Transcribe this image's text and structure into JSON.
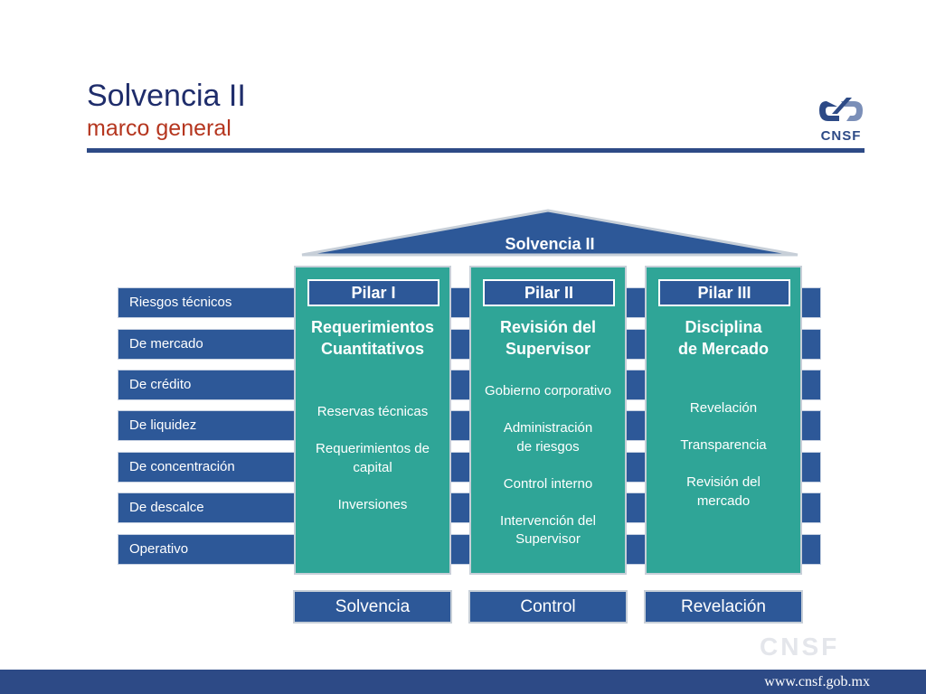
{
  "header": {
    "title": "Solvencia II",
    "subtitle": "marco general"
  },
  "logo": {
    "text": "CNSF",
    "icon": "cnsf-logo-icon"
  },
  "roof": {
    "label": "Solvencia II"
  },
  "risks": [
    "Riesgos técnicos",
    "De mercado",
    "De crédito",
    "De liquidez",
    "De concentración",
    "De descalce",
    "Operativo"
  ],
  "pillars": [
    {
      "label": "Pilar I",
      "title": "Requerimientos\nCuantitativos",
      "items": [
        "Reservas técnicas",
        "Requerimientos de\ncapital",
        "Inversiones"
      ]
    },
    {
      "label": "Pilar II",
      "title": "Revisión del\nSupervisor",
      "items": [
        "Gobierno corporativo",
        "Administración\nde riesgos",
        "Control interno",
        "Intervención del\nSupervisor"
      ]
    },
    {
      "label": "Pilar III",
      "title": "Disciplina\nde Mercado",
      "items": [
        "Revelación",
        "Transparencia",
        "Revisión del\nmercado"
      ]
    }
  ],
  "outcomes": [
    "Solvencia",
    "Control",
    "Revelación"
  ],
  "watermark": "CNSF",
  "footer": {
    "url": "www.cnsf.gob.mx"
  },
  "colors": {
    "navy": "#2d4a86",
    "blue": "#2d5898",
    "teal": "#2fa597",
    "accent_red": "#b5361f"
  }
}
